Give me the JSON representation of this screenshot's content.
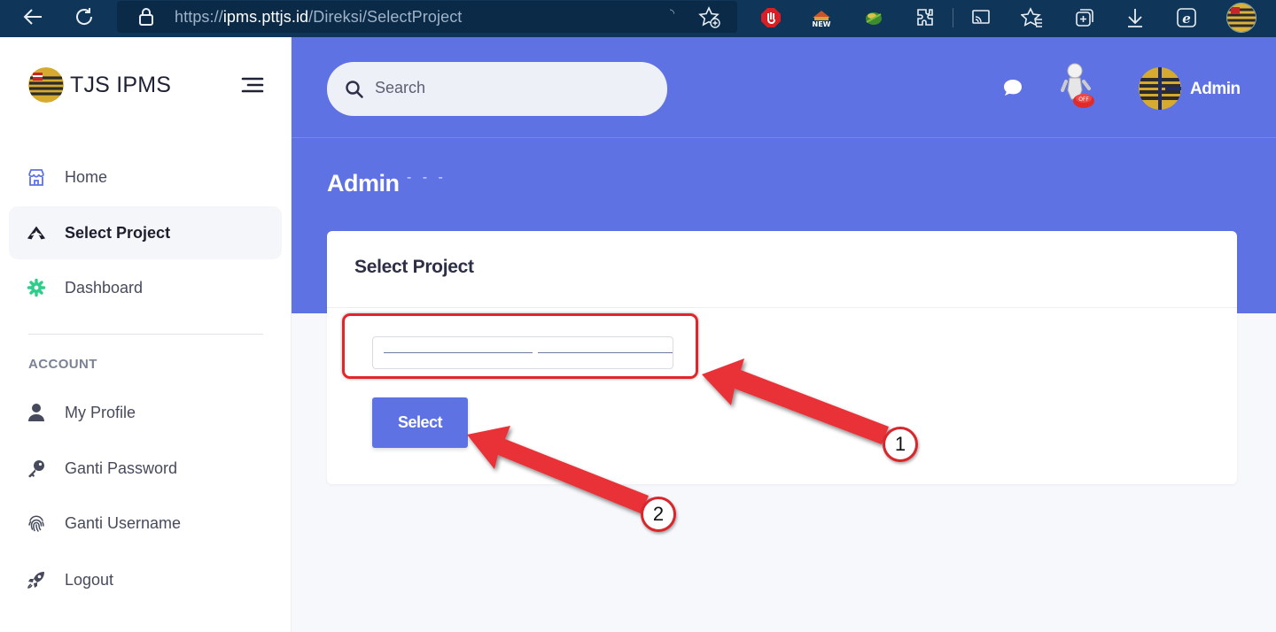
{
  "browser": {
    "url_prefix": "https://",
    "url_host": "ipms.pttjs.id",
    "url_path": "/Direksi/SelectProject",
    "icons": [
      "back-icon",
      "refresh-icon",
      "lock-icon",
      "read-aloud-icon",
      "favorite-add-icon",
      "adblock-icon",
      "new-extension-icon",
      "globe-extension-icon",
      "extensions-icon",
      "cast-icon",
      "favorites-icon",
      "collections-icon",
      "download-icon",
      "edge-icon",
      "profile-icon"
    ]
  },
  "sidebar": {
    "brand": "TJS IPMS",
    "items": [
      {
        "label": "Home",
        "icon": "home-icon",
        "active": false
      },
      {
        "label": "Select Project",
        "icon": "project-icon",
        "active": true
      },
      {
        "label": "Dashboard",
        "icon": "gear-icon",
        "active": false
      }
    ],
    "section_title": "ACCOUNT",
    "account_items": [
      {
        "label": "My Profile",
        "icon": "user-icon"
      },
      {
        "label": "Ganti Password",
        "icon": "key-icon"
      },
      {
        "label": "Ganti Username",
        "icon": "fingerprint-icon"
      },
      {
        "label": "Logout",
        "icon": "rocket-icon"
      }
    ]
  },
  "header": {
    "search_placeholder": "Search",
    "user_name": "Admin",
    "page_title": "Admin",
    "page_subtitle": "- - -"
  },
  "card": {
    "title": "Select Project",
    "select_button": "Select"
  },
  "annotations": {
    "callout_1": "1",
    "callout_2": "2"
  },
  "colors": {
    "primary": "#5e72e4",
    "browser_bar": "#0f3558",
    "annotation_red": "#e2252b",
    "active_bg": "#f4f6fa"
  }
}
